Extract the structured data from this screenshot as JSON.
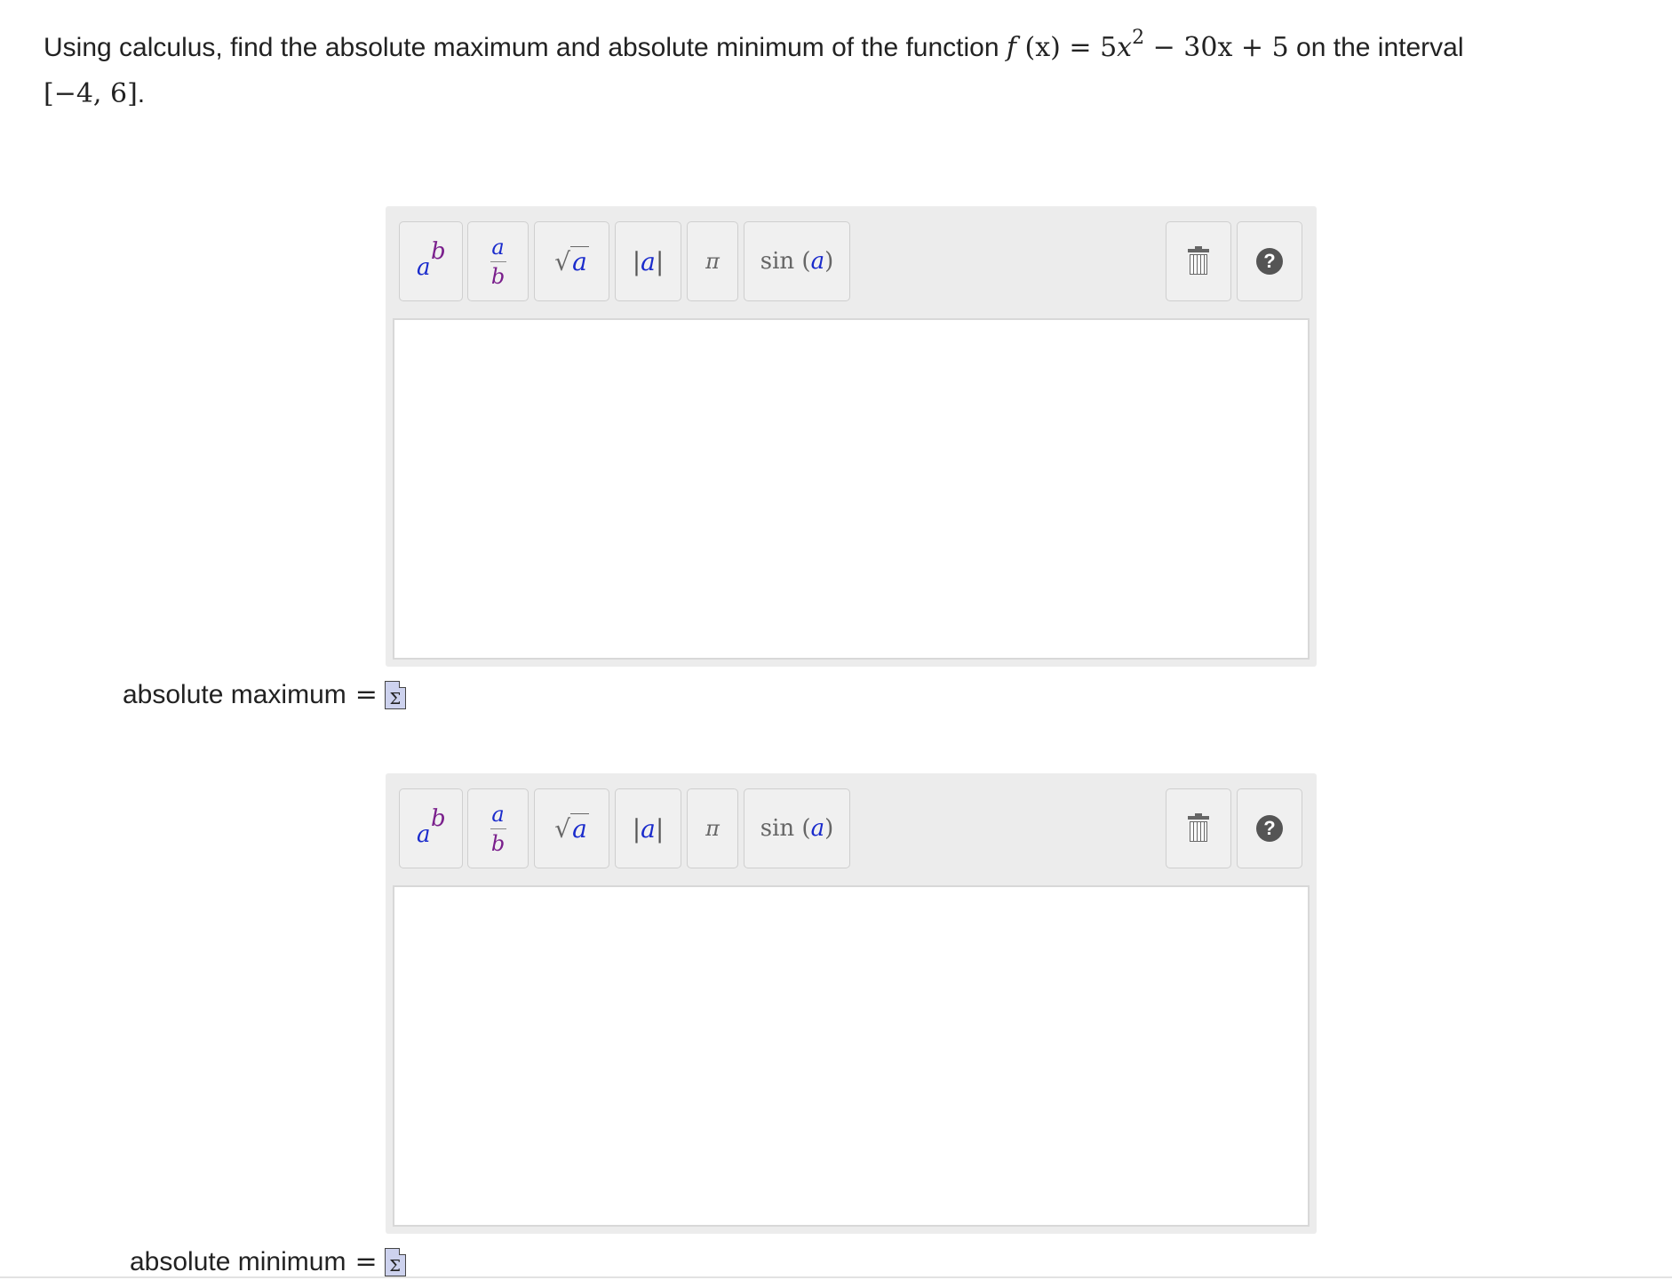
{
  "question": {
    "text_before": "Using calculus, find the absolute maximum and absolute minimum of the function ",
    "func_f": "f",
    "func_arg": "(x)",
    "func_eq": " = 5",
    "func_x": "x",
    "func_exp": "2",
    "func_rest": " − 30x + 5",
    "text_after": " on the interval",
    "interval": "[−4, 6]",
    "period": "."
  },
  "toolbar": {
    "pow_base": "a",
    "pow_exp": "b",
    "frac_num": "a",
    "frac_den": "b",
    "sqrt_symbol": "√",
    "sqrt_arg": "a",
    "abs_left": "|",
    "abs_arg": "a",
    "abs_right": "|",
    "pi_symbol": "π",
    "sin_func": "sin",
    "sin_open": " (",
    "sin_arg": "a",
    "sin_close": ")",
    "help_symbol": "?"
  },
  "answers": {
    "max_label": "absolute maximum",
    "min_label": "absolute minimum",
    "equals": "=",
    "sigma": "Σ"
  }
}
